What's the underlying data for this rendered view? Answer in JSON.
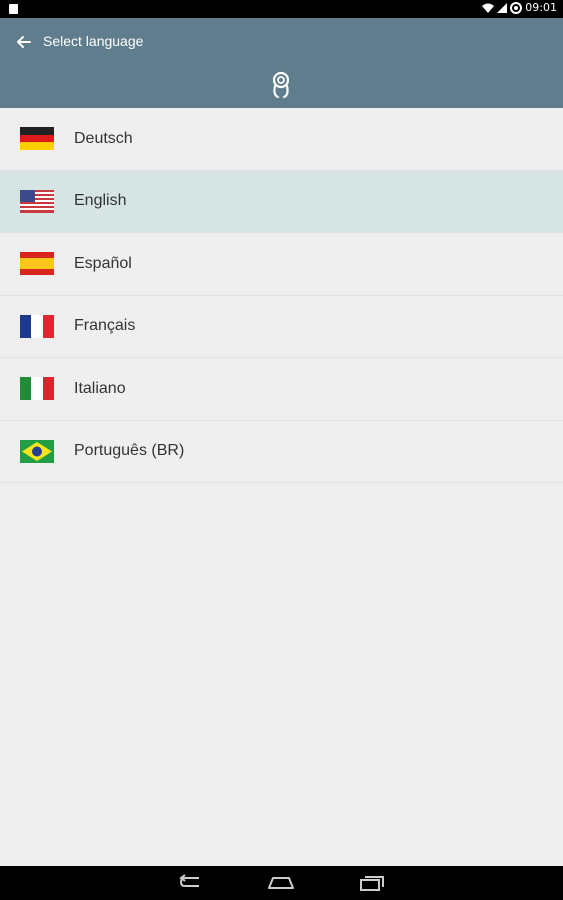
{
  "status": {
    "time": "09:01"
  },
  "header": {
    "title": "Select language"
  },
  "languages": [
    {
      "label": "Deutsch",
      "flag": "de-flag-icon",
      "selected": false
    },
    {
      "label": "English",
      "flag": "us-flag-icon",
      "selected": true
    },
    {
      "label": "Español",
      "flag": "es-flag-icon",
      "selected": false
    },
    {
      "label": "Français",
      "flag": "fr-flag-icon",
      "selected": false
    },
    {
      "label": "Italiano",
      "flag": "it-flag-icon",
      "selected": false
    },
    {
      "label": "Português (BR)",
      "flag": "br-flag-icon",
      "selected": false
    }
  ],
  "colors": {
    "app_bar": "#5f7d8c",
    "selected_row": "#d6e5e4",
    "background": "#efefef"
  }
}
